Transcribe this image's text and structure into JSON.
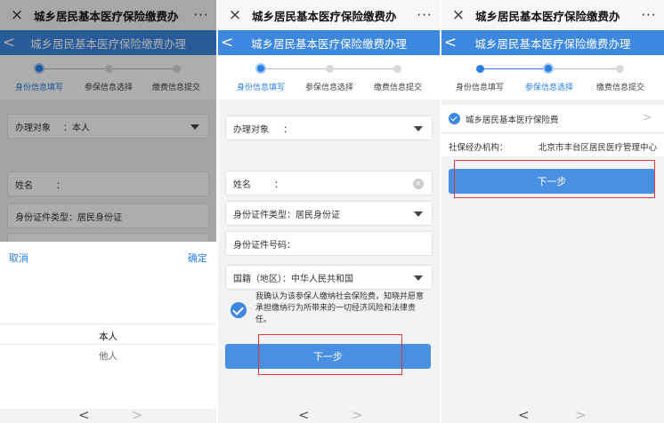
{
  "window": {
    "title": "城乡居民基本医疗保险缴费办",
    "close_glyph": "×",
    "more_glyph": "···"
  },
  "header": {
    "title": "城乡居民基本医疗保险缴费办理",
    "back_glyph": "<"
  },
  "steps": [
    "身份信息填写",
    "参保信息选择",
    "缴费信息提交"
  ],
  "panel1": {
    "field_target_label": "办理对象",
    "field_target_value": "：本人",
    "field_name_label": "姓名",
    "field_name_value": "：",
    "field_idtype_label": "身份证件类型：居民身份证",
    "picker": {
      "cancel": "取消",
      "confirm": "确定",
      "options": [
        "本人",
        "他人"
      ]
    }
  },
  "panel2": {
    "field_target_label": "办理对象",
    "field_target_value": "：",
    "field_name_label": "姓名",
    "field_name_value": "：",
    "field_idtype_label": "身份证件类型：居民身份证",
    "field_idno_label": "身份证件号码：",
    "field_nation_label": "国籍（地区）：中华人民共和国",
    "agreement": "我确认为该参保人缴纳社会保险费，知晓并愿意承担缴纳行为所带来的一切经济风险和法律责任。",
    "next_button": "下一步"
  },
  "panel3": {
    "insurance_item": "城乡居民基本医疗保险费",
    "chevron": ">",
    "agency_label": "社保经办机构：",
    "agency_value": "北京市丰台区居民医疗管理中心",
    "next_button": "下一步"
  },
  "nav": {
    "back_glyph": "<",
    "forward_glyph": ">"
  },
  "colors": {
    "accent": "#3c87e0",
    "highlight_box": "#e0393e"
  }
}
